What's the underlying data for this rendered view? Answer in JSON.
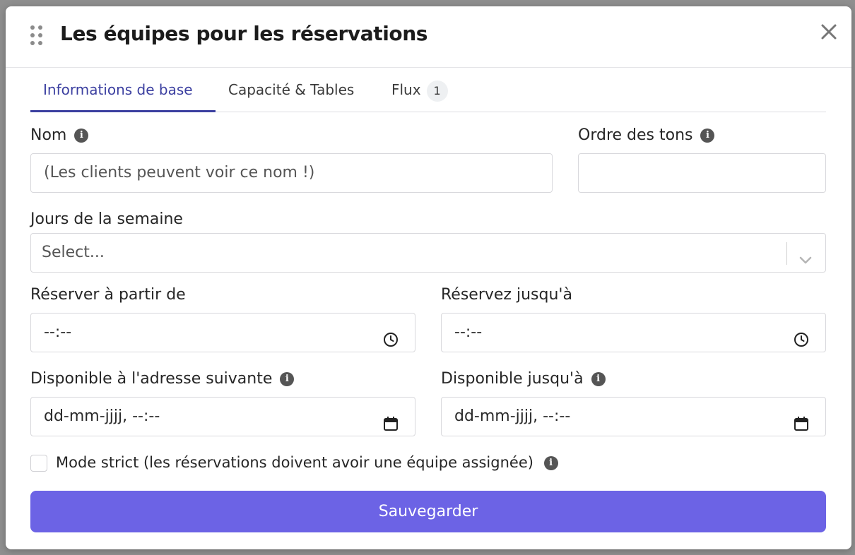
{
  "modal": {
    "title": "Les équipes pour les réservations"
  },
  "tabs": [
    {
      "label": "Informations de base",
      "active": true
    },
    {
      "label": "Capacité & Tables",
      "active": false
    },
    {
      "label": "Flux",
      "badge": "1",
      "active": false
    }
  ],
  "form": {
    "name_label": "Nom",
    "name_placeholder": "(Les clients peuvent voir ce nom !)",
    "order_label": "Ordre des tons",
    "order_value": "",
    "days_label": "Jours de la semaine",
    "days_placeholder": "Select...",
    "reserve_from_label": "Réserver à partir de",
    "reserve_from_value": "--:--",
    "reserve_until_label": "Réservez jusqu'à",
    "reserve_until_value": "--:--",
    "available_from_label": "Disponible à l'adresse suivante",
    "available_from_value": "dd-mm-jjjj, --:--",
    "available_until_label": "Disponible jusqu'à",
    "available_until_value": "dd-mm-jjjj, --:--",
    "strict_mode_label": "Mode strict (les réservations doivent avoir une équipe assignée)",
    "strict_mode_checked": false
  },
  "actions": {
    "save_label": "Sauvegarder"
  },
  "colors": {
    "accent": "#3b3fa0",
    "button": "#6c63e5",
    "backdrop": "#8f8f8f"
  },
  "icons": {
    "drag": "drag-handle-icon",
    "close": "close-icon",
    "info": "info-icon",
    "clock": "clock-icon",
    "calendar": "calendar-icon",
    "chevron": "chevron-down-icon"
  }
}
